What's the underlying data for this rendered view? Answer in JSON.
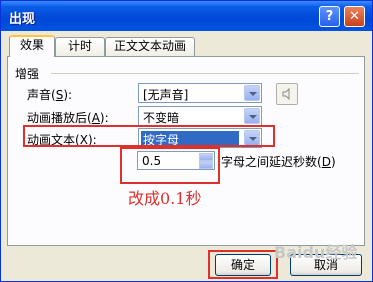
{
  "dialog": {
    "title": "出现",
    "help_glyph": "?",
    "close_glyph": "✕"
  },
  "tabs": [
    {
      "label": "效果"
    },
    {
      "label": "计时"
    },
    {
      "label": "正文文本动画"
    }
  ],
  "section": {
    "title": "增强"
  },
  "fields": {
    "sound_label": "声音",
    "sound_key": "S",
    "sound_value": "[无声音]",
    "after_anim_label": "动画播放后",
    "after_anim_key": "A",
    "after_anim_value": "不变暗",
    "anim_text_label": "动画文本",
    "anim_text_key": "X",
    "anim_text_value": "按字母",
    "delay_value": "0.5",
    "delay_label": "字母之间延迟秒数",
    "delay_key": "D",
    "colon": ":",
    "key_open": "(",
    "key_close": ")"
  },
  "annotation": {
    "text": "改成0.1秒",
    "color": "#e0302c"
  },
  "buttons": {
    "ok": "确定",
    "cancel": "取消"
  },
  "watermark": "Baidu经验"
}
